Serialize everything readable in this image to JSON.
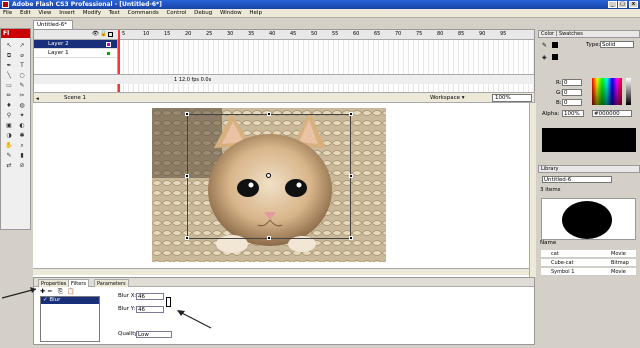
{
  "window": {
    "title": "Adobe Flash CS3 Professional - [Untitled-6*]",
    "btn_min": "_",
    "btn_max": "□",
    "btn_close": "x"
  },
  "menu": [
    "File",
    "Edit",
    "View",
    "Insert",
    "Modify",
    "Text",
    "Commands",
    "Control",
    "Debug",
    "Window",
    "Help"
  ],
  "tools": {
    "logo": "Fl",
    "glyphs": [
      "↖",
      "↗",
      "⧉",
      "⌀",
      "✒",
      "T",
      "╲",
      "○",
      "▭",
      "✎",
      "✏",
      "✂",
      "♦",
      "◍",
      "⚲",
      "✦",
      "▣",
      "◐",
      "◑",
      "✱",
      "✋",
      "⌕",
      "✎",
      "▮",
      "⇄",
      "⊘"
    ]
  },
  "document": {
    "tab": "Untitled-6*"
  },
  "timeline": {
    "layers": [
      {
        "name": "Layer 2",
        "selected": true
      },
      {
        "name": "Layer 1",
        "selected": false
      }
    ],
    "ruler": [
      "5",
      "10",
      "15",
      "20",
      "25",
      "30",
      "35",
      "40",
      "45",
      "50",
      "55",
      "60",
      "65",
      "70",
      "75",
      "80",
      "85",
      "90",
      "95"
    ],
    "footer": "1   12.0 fps   0.0s"
  },
  "editbar": {
    "scene": "Scene 1",
    "workspace": "Workspace ▾",
    "zoom": "100%"
  },
  "properties": {
    "tabs": [
      "Properties",
      "Filters",
      "Parameters"
    ],
    "active_tab": "Filters",
    "filter_item": "Blur",
    "blur_x_label": "Blur X:",
    "blur_x_value": "46",
    "blur_y_label": "Blur Y:",
    "blur_y_value": "46",
    "quality_label": "Quality:",
    "quality_value": "Low"
  },
  "color_panel": {
    "tabs": [
      "Color",
      "Swatches"
    ],
    "type_label": "Type:",
    "type_value": "Solid",
    "r_label": "R:",
    "r_value": "0",
    "g_label": "G:",
    "g_value": "0",
    "b_label": "B:",
    "b_value": "0",
    "alpha_label": "Alpha:",
    "alpha_value": "100%",
    "hex": "#000000",
    "preview_color": "#000000"
  },
  "library": {
    "title": "Library",
    "doc_select": "Untitled-6",
    "count": "3 items",
    "col_name": "Name",
    "items": [
      {
        "name": "cat",
        "type": "Movie"
      },
      {
        "name": "Cube-cat",
        "type": "Bitmap"
      },
      {
        "name": "Symbol 1",
        "type": "Movie"
      }
    ]
  }
}
